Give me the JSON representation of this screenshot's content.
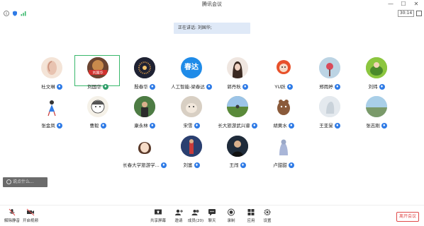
{
  "window": {
    "title": "腾讯会议",
    "minimize": "—",
    "maximize": "☐",
    "close": "✕"
  },
  "status": {
    "timer": "30:14"
  },
  "speaking": {
    "text": "正在讲话: 刘国华;"
  },
  "participants": [
    {
      "name": "杜文琳"
    },
    {
      "name": "刘国华",
      "avatar_text": "刘国华"
    },
    {
      "name": "殷春华"
    },
    {
      "name": "人工智能-梁春达",
      "avatar_text": "春达"
    },
    {
      "name": "郭丹秋"
    },
    {
      "name": "YU跃"
    },
    {
      "name": "郑雨婷"
    },
    {
      "name": "刘玮"
    },
    {
      "name": "张金凤"
    },
    {
      "name": "曹毅"
    },
    {
      "name": "康永林"
    },
    {
      "name": "宋雪"
    },
    {
      "name": "长大旅游武兴睿"
    },
    {
      "name": "胡黄水"
    },
    {
      "name": "王亚旻"
    },
    {
      "name": "张志刚"
    },
    {
      "name": "长春大学旅游学..."
    },
    {
      "name": "刘富"
    },
    {
      "name": "王闯"
    },
    {
      "name": "卢甜甜"
    }
  ],
  "chat": {
    "placeholder": "说点什么..."
  },
  "toolbar": {
    "mute": "解除静音",
    "video": "开启视频",
    "share": "共享屏幕",
    "invite": "邀请",
    "members": "成员(20)",
    "chat": "聊天",
    "record": "录制",
    "apps": "应用",
    "settings": "设置",
    "leave": "离开会议"
  },
  "colors": {
    "accent": "#2f7be6",
    "active_speaker": "#39b86c",
    "leave": "#e04a4a"
  }
}
